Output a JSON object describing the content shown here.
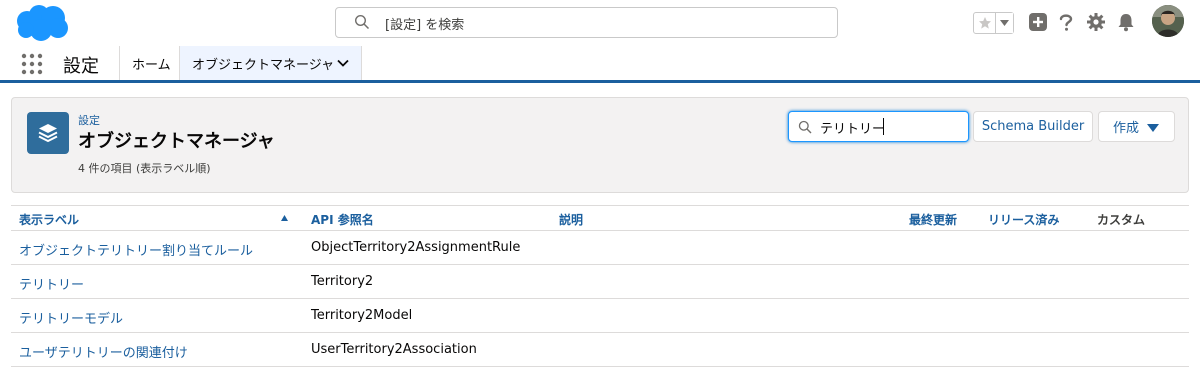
{
  "header": {
    "search_placeholder": "[設定] を検索"
  },
  "context_bar": {
    "app_name": "設定",
    "tabs": [
      {
        "label": "ホーム"
      },
      {
        "label": "オブジェクトマネージャ"
      }
    ]
  },
  "page_header": {
    "breadcrumb": "設定",
    "title": "オブジェクトマネージャ",
    "subtitle": "4 件の項目 (表示ラベル順)",
    "quick_find_value": "テリトリー",
    "schema_builder_label": "Schema Builder",
    "create_label": "作成"
  },
  "table": {
    "columns": [
      "表示ラベル",
      "API 参照名",
      "説明",
      "最終更新",
      "リリース済み",
      "カスタム"
    ],
    "rows": [
      {
        "label": "オブジェクトテリトリー割り当てルール",
        "api": "ObjectTerritory2AssignmentRule"
      },
      {
        "label": "テリトリー",
        "api": "Territory2"
      },
      {
        "label": "テリトリーモデル",
        "api": "Territory2Model"
      },
      {
        "label": "ユーザテリトリーの関連付け",
        "api": "UserTerritory2Association"
      }
    ]
  },
  "colors": {
    "brand_blue": "#1b5f9e",
    "cloud_blue": "#1b96ff",
    "icon_tile": "#2f6d9c"
  }
}
